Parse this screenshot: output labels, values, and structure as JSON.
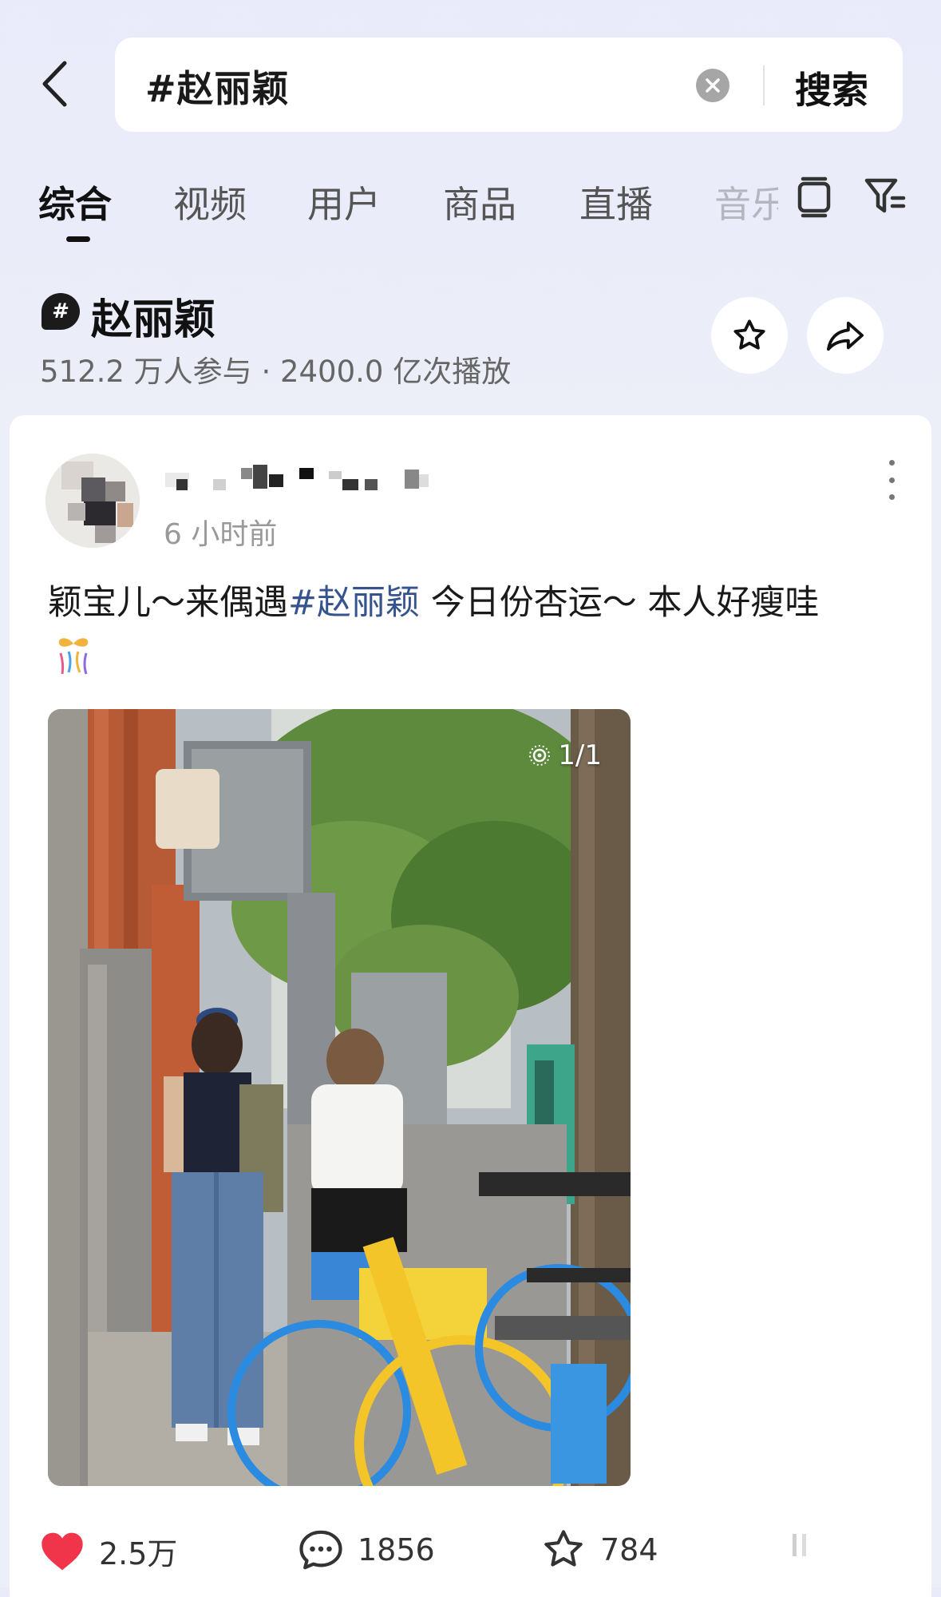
{
  "search": {
    "query": "#赵丽颖",
    "button_label": "搜索"
  },
  "tabs": [
    {
      "label": "综合"
    },
    {
      "label": "视频"
    },
    {
      "label": "用户"
    },
    {
      "label": "商品"
    },
    {
      "label": "直播"
    },
    {
      "label": "音乐"
    }
  ],
  "topic": {
    "icon_glyph": "#",
    "title": "赵丽颖",
    "stats": "512.2 万人参与 · 2400.0 亿次播放"
  },
  "post": {
    "time": "6 小时前",
    "text_before": "颖宝儿～来偶遇",
    "hashtag": "#赵丽颖",
    "text_after": " 今日份杏运～ 本人好瘦哇",
    "photo_count": "1/1",
    "likes": "2.5万",
    "comments": "1856",
    "favorites": "784"
  },
  "icons": {
    "back": "chevron-left-icon",
    "clear": "clear-icon",
    "layout": "layout-icon",
    "filter": "filter-icon",
    "star": "star-icon",
    "share": "share-icon",
    "more": "more-icon",
    "like": "heart-icon",
    "comment": "comment-icon",
    "favorite": "star-outline-icon"
  },
  "colors": {
    "background": "#eceef8",
    "hashtag": "#35538f",
    "like": "#f0344a"
  }
}
